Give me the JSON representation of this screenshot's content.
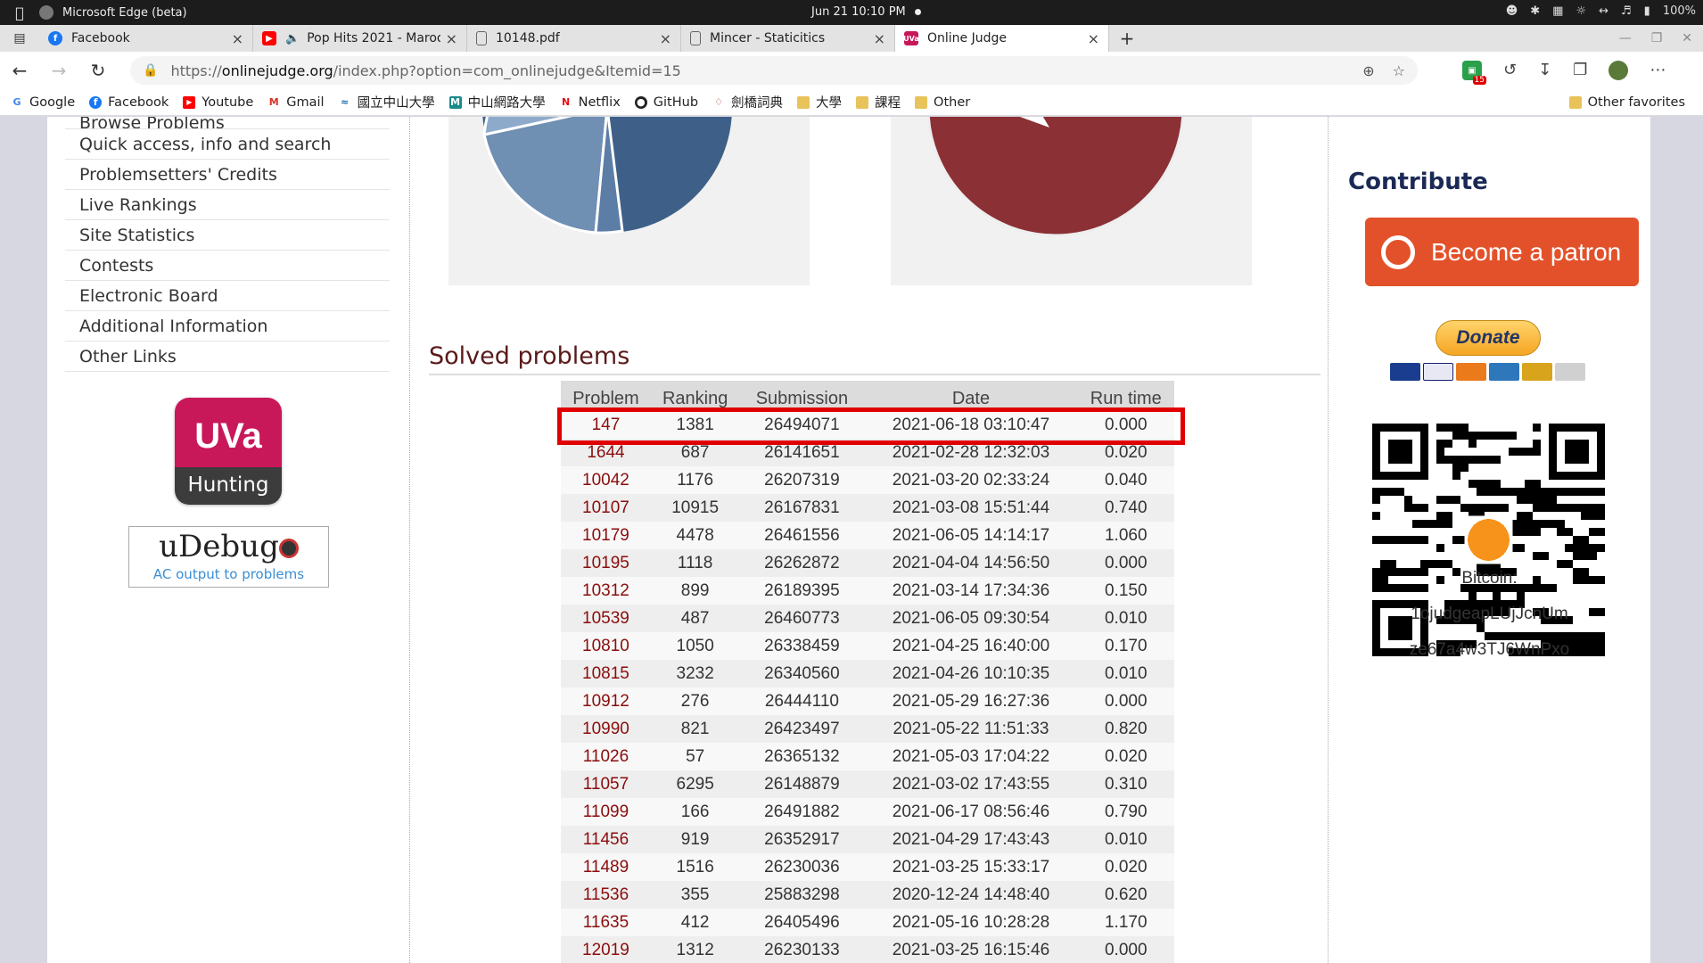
{
  "os": {
    "app_name": "Microsoft Edge (beta)",
    "clock": "Jun 21  10:10 PM",
    "battery": "100%"
  },
  "tabs": [
    {
      "label": "Facebook",
      "icon": "facebook-icon",
      "color": "#1877f2"
    },
    {
      "label": "Pop Hits 2021 - Maroo",
      "icon": "youtube-icon",
      "color": "#ff0000"
    },
    {
      "label": "10148.pdf",
      "icon": "document-icon",
      "color": "#666666"
    },
    {
      "label": "Mincer - Staticitics",
      "icon": "document-icon",
      "color": "#666666"
    },
    {
      "label": "Online Judge",
      "icon": "uva-icon",
      "color": "#c8185a"
    }
  ],
  "address": {
    "scheme": "https://",
    "domain": "onlinejudge.org",
    "path": "/index.php?option=com_onlinejudge&Itemid=15"
  },
  "extension_badge": "15",
  "bookmarks": [
    "Google",
    "Facebook",
    "Youtube",
    "Gmail",
    "國立中山大學",
    "中山網路大學",
    "Netflix",
    "GitHub",
    "劍橋詞典",
    "大學",
    "課程",
    "Other"
  ],
  "other_favorites": "Other favorites",
  "menu": [
    "Browse Problems",
    "Quick access, info and search",
    "Problemsetters' Credits",
    "Live Rankings",
    "Site Statistics",
    "Contests",
    "Electronic Board",
    "Additional Information",
    "Other Links"
  ],
  "uva_logo": {
    "top": "UVa",
    "bottom": "Hunting"
  },
  "udebug": {
    "title": "uDebug",
    "subtitle": "AC output to problems"
  },
  "solved": {
    "title": "Solved problems",
    "headers": [
      "Problem",
      "Ranking",
      "Submission",
      "Date",
      "Run time"
    ],
    "rows": [
      [
        "147",
        "1381",
        "26494071",
        "2021-06-18 03:10:47",
        "0.000"
      ],
      [
        "1644",
        "687",
        "26141651",
        "2021-02-28 12:32:03",
        "0.020"
      ],
      [
        "10042",
        "1176",
        "26207319",
        "2021-03-20 02:33:24",
        "0.040"
      ],
      [
        "10107",
        "10915",
        "26167831",
        "2021-03-08 15:51:44",
        "0.740"
      ],
      [
        "10179",
        "4478",
        "26461556",
        "2021-06-05 14:14:17",
        "1.060"
      ],
      [
        "10195",
        "1118",
        "26262872",
        "2021-04-04 14:56:50",
        "0.000"
      ],
      [
        "10312",
        "899",
        "26189395",
        "2021-03-14 17:34:36",
        "0.150"
      ],
      [
        "10539",
        "487",
        "26460773",
        "2021-06-05 09:30:54",
        "0.010"
      ],
      [
        "10810",
        "1050",
        "26338459",
        "2021-04-25 16:40:00",
        "0.170"
      ],
      [
        "10815",
        "3232",
        "26340560",
        "2021-04-26 10:10:35",
        "0.010"
      ],
      [
        "10912",
        "276",
        "26444110",
        "2021-05-29 16:27:36",
        "0.000"
      ],
      [
        "10990",
        "821",
        "26423497",
        "2021-05-22 11:51:33",
        "0.820"
      ],
      [
        "11026",
        "57",
        "26365132",
        "2021-05-03 17:04:22",
        "0.020"
      ],
      [
        "11057",
        "6295",
        "26148879",
        "2021-03-02 17:43:55",
        "0.310"
      ],
      [
        "11099",
        "166",
        "26491882",
        "2021-06-17 08:56:46",
        "0.790"
      ],
      [
        "11456",
        "919",
        "26352917",
        "2021-04-29 17:43:43",
        "0.010"
      ],
      [
        "11489",
        "1516",
        "26230036",
        "2021-03-25 15:33:17",
        "0.020"
      ],
      [
        "11536",
        "355",
        "25883298",
        "2020-12-24 14:48:40",
        "0.620"
      ],
      [
        "11635",
        "412",
        "26405496",
        "2021-05-16 10:28:28",
        "1.170"
      ],
      [
        "12019",
        "1312",
        "26230133",
        "2021-03-25 16:15:46",
        "0.000"
      ]
    ]
  },
  "contribute": {
    "title": "Contribute",
    "patron": "Become a patron",
    "donate": "Donate",
    "bitcoin_label": "Bitcoin:",
    "bitcoin_line1": "1ojudgeapLUjJcnUm",
    "bitcoin_line2": "ze67a4w3TJ6WnPxo"
  },
  "colors": {
    "accent": "#c8185a",
    "problem_link": "#8b0d0d",
    "highlight": "#e00000",
    "patron": "#e3512a"
  }
}
